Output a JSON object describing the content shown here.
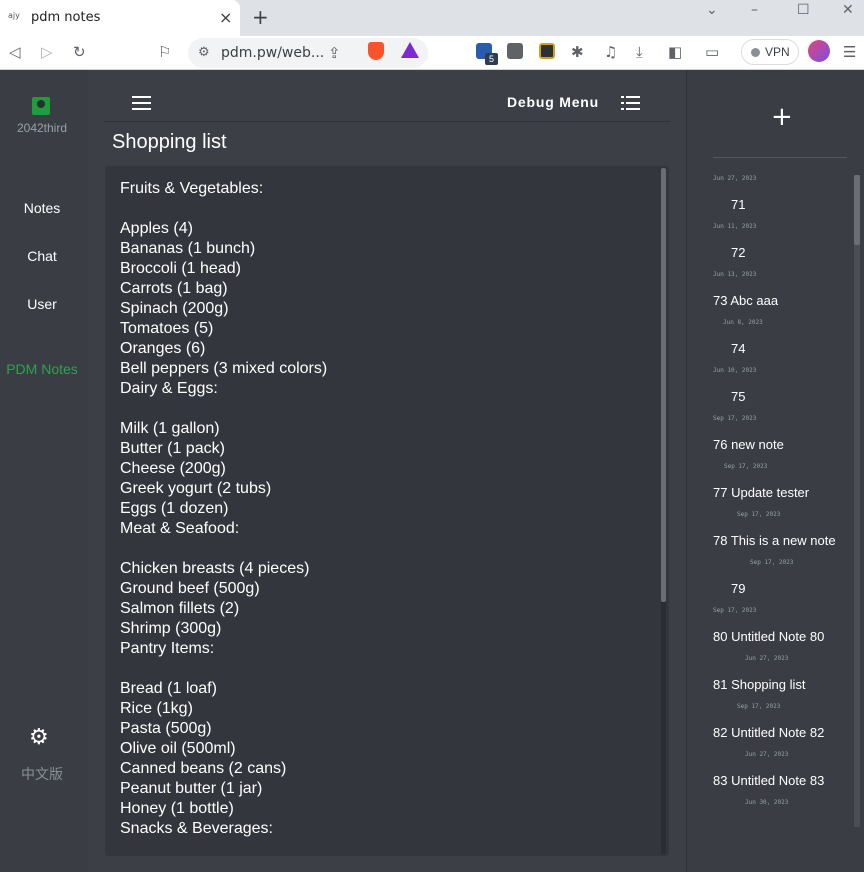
{
  "browser": {
    "tab_title": "pdm notes",
    "tab_favicon": "ajy",
    "tab_close": "×",
    "new_tab": "+",
    "url": "pdm.pw/web...",
    "vpn_label": "VPN",
    "ext_badge": "5"
  },
  "sidebar": {
    "username": "2042third",
    "items": [
      {
        "label": "Notes"
      },
      {
        "label": "Chat"
      },
      {
        "label": "User"
      }
    ],
    "brand": "PDM Notes",
    "language": "中文版"
  },
  "header": {
    "debug_menu": "Debug Menu"
  },
  "note": {
    "title": "Shopping list",
    "lines": [
      "Fruits & Vegetables:",
      "",
      "Apples (4)",
      "Bananas (1 bunch)",
      "Broccoli (1 head)",
      "Carrots (1 bag)",
      "Spinach (200g)",
      "Tomatoes (5)",
      "Oranges (6)",
      "Bell peppers (3 mixed colors)",
      "Dairy & Eggs:",
      "",
      "Milk (1 gallon)",
      "Butter (1 pack)",
      "Cheese (200g)",
      "Greek yogurt (2 tubs)",
      "Eggs (1 dozen)",
      "Meat & Seafood:",
      "",
      "Chicken breasts (4 pieces)",
      "Ground beef (500g)",
      "Salmon fillets (2)",
      "Shrimp (300g)",
      "Pantry Items:",
      "",
      "Bread (1 loaf)",
      "Rice (1kg)",
      "Pasta (500g)",
      "Olive oil (500ml)",
      "Canned beans (2 cans)",
      "Peanut butter (1 jar)",
      "Honey (1 bottle)",
      "Snacks & Beverages:"
    ]
  },
  "notes_list": {
    "add_label": "+",
    "top_date": "Jun 27, 2023",
    "items": [
      {
        "label": "71",
        "date": "Jun 11, 2023"
      },
      {
        "label": "72",
        "date": "Jun 13, 2023"
      },
      {
        "label": "73 Abc aaa",
        "date": "Jun 8, 2023"
      },
      {
        "label": "74",
        "date": "Jun 10, 2023"
      },
      {
        "label": "75",
        "date": "Sep 17, 2023"
      },
      {
        "label": "76 new note",
        "date": "Sep 17, 2023"
      },
      {
        "label": "77 Update tester",
        "date": "Sep 17, 2023"
      },
      {
        "label": "78 This is a new note",
        "date": "Sep 17, 2023"
      },
      {
        "label": "79",
        "date": "Sep 17, 2023"
      },
      {
        "label": "80 Untitled Note 80",
        "date": "Jun 27, 2023"
      },
      {
        "label": "81 Shopping list",
        "date": "Sep 17, 2023"
      },
      {
        "label": "82 Untitled Note 82",
        "date": "Jun 27, 2023"
      },
      {
        "label": "83 Untitled Note 83",
        "date": "Jun 30, 2023"
      }
    ]
  },
  "colors": {
    "accent_green": "#2ea44f",
    "panel_bg": "#3a3d44",
    "editor_bg": "#33363c"
  }
}
